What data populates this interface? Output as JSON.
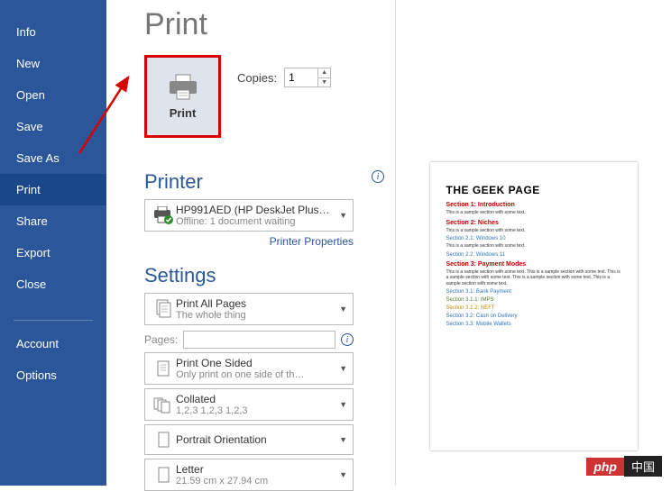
{
  "sidebar": {
    "items": [
      {
        "label": "Info"
      },
      {
        "label": "New"
      },
      {
        "label": "Open"
      },
      {
        "label": "Save"
      },
      {
        "label": "Save As"
      },
      {
        "label": "Print"
      },
      {
        "label": "Share"
      },
      {
        "label": "Export"
      },
      {
        "label": "Close"
      }
    ],
    "footer": [
      {
        "label": "Account"
      },
      {
        "label": "Options"
      }
    ]
  },
  "page": {
    "title": "Print"
  },
  "print_button": {
    "label": "Print"
  },
  "copies": {
    "label": "Copies:",
    "value": "1"
  },
  "printer_section": {
    "title": "Printer",
    "selected": {
      "name": "HP991AED (HP DeskJet Plus…",
      "status": "Offline: 1 document waiting"
    },
    "properties_link": "Printer Properties"
  },
  "settings_section": {
    "title": "Settings"
  },
  "print_all": {
    "line1": "Print All Pages",
    "line2": "The whole thing"
  },
  "pages": {
    "label": "Pages:",
    "value": ""
  },
  "one_sided": {
    "line1": "Print One Sided",
    "line2": "Only print on one side of th…"
  },
  "collated": {
    "line1": "Collated",
    "line2": "1,2,3    1,2,3    1,2,3"
  },
  "orientation": {
    "line1": "Portrait Orientation"
  },
  "paper": {
    "line1": "Letter",
    "line2": "21.59 cm x 27.94 cm"
  },
  "preview": {
    "title": "THE GEEK PAGE",
    "s1": "Section 1: Introduction",
    "s1b": "This is a sample section with some text.",
    "s2": "Section 2: Niches",
    "s2b": "This is a sample section with some text.",
    "s21": "Section 2.1: Windows 10",
    "s21b": "This is a sample section with some text.",
    "s22": "Section 2.2: Windows 11",
    "s3": "Section 3: Payment Modes",
    "s3b": "This is a sample section with some text. This is a sample section with some text. This is a sample section with some text. This is a sample section with some text. This is a sample section with some text.",
    "s31": "Section 3.1: Bank Payment",
    "s311": "Section 3.1.1: IMPS",
    "s312": "Section 3.1.2: NEFT",
    "s32": "Section 3.2: Cash on Delivery",
    "s33": "Section 3.3: Mobile Wallets"
  },
  "watermark": {
    "php": "php",
    "cn": "中国"
  }
}
